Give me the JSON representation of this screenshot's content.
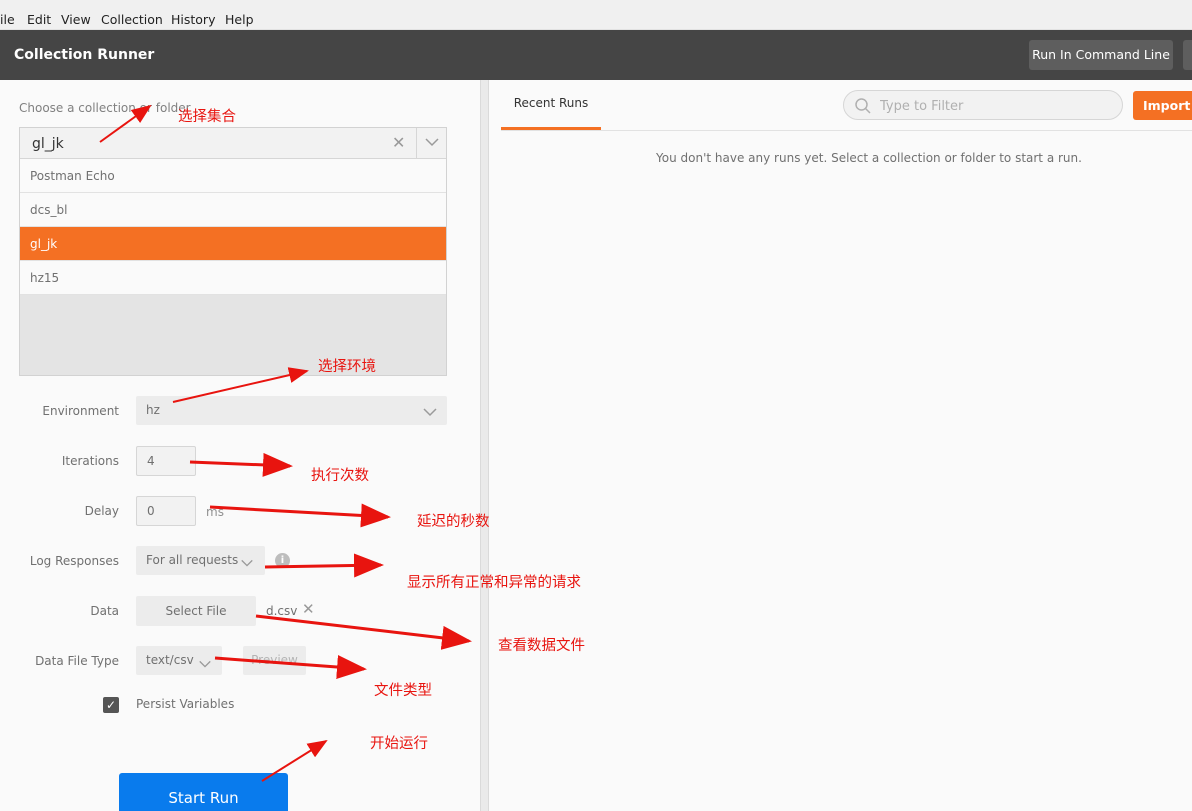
{
  "menu": [
    "ile",
    "Edit",
    "View",
    "Collection",
    "History",
    "Help"
  ],
  "header": {
    "title": "Collection Runner",
    "run_cmd_label": "Run In Command Line"
  },
  "left": {
    "choose_label": "Choose a collection or folder",
    "selected_collection": "gl_jk",
    "collections": [
      "Postman Echo",
      "dcs_bl",
      "gl_jk",
      "hz15"
    ],
    "environment": {
      "label": "Environment",
      "value": "hz"
    },
    "iterations": {
      "label": "Iterations",
      "value": "4"
    },
    "delay": {
      "label": "Delay",
      "value": "0",
      "unit": "ms"
    },
    "log_responses": {
      "label": "Log Responses",
      "value": "For all requests"
    },
    "data": {
      "label": "Data",
      "button": "Select File",
      "file": "d.csv"
    },
    "data_file_type": {
      "label": "Data File Type",
      "value": "text/csv",
      "preview": "Preview"
    },
    "persist_variables": {
      "label": "Persist Variables",
      "checked": true
    },
    "start_run_label": "Start Run"
  },
  "right": {
    "tab": "Recent Runs",
    "filter_placeholder": "Type to Filter",
    "import_label": "Import To",
    "empty_message": "You don't have any runs yet. Select a collection or folder to start a run."
  },
  "annotations": {
    "choose_collection": "选择集合",
    "choose_environment": "选择环境",
    "iterations": "执行次数",
    "delay": "延迟的秒数",
    "log_responses": "显示所有正常和异常的请求",
    "data": "查看数据文件",
    "file_type": "文件类型",
    "start_run": "开始运行"
  },
  "colors": {
    "accent": "#f47023",
    "start_run": "#097bed",
    "annotation": "#e8140f",
    "header": "#454545"
  }
}
